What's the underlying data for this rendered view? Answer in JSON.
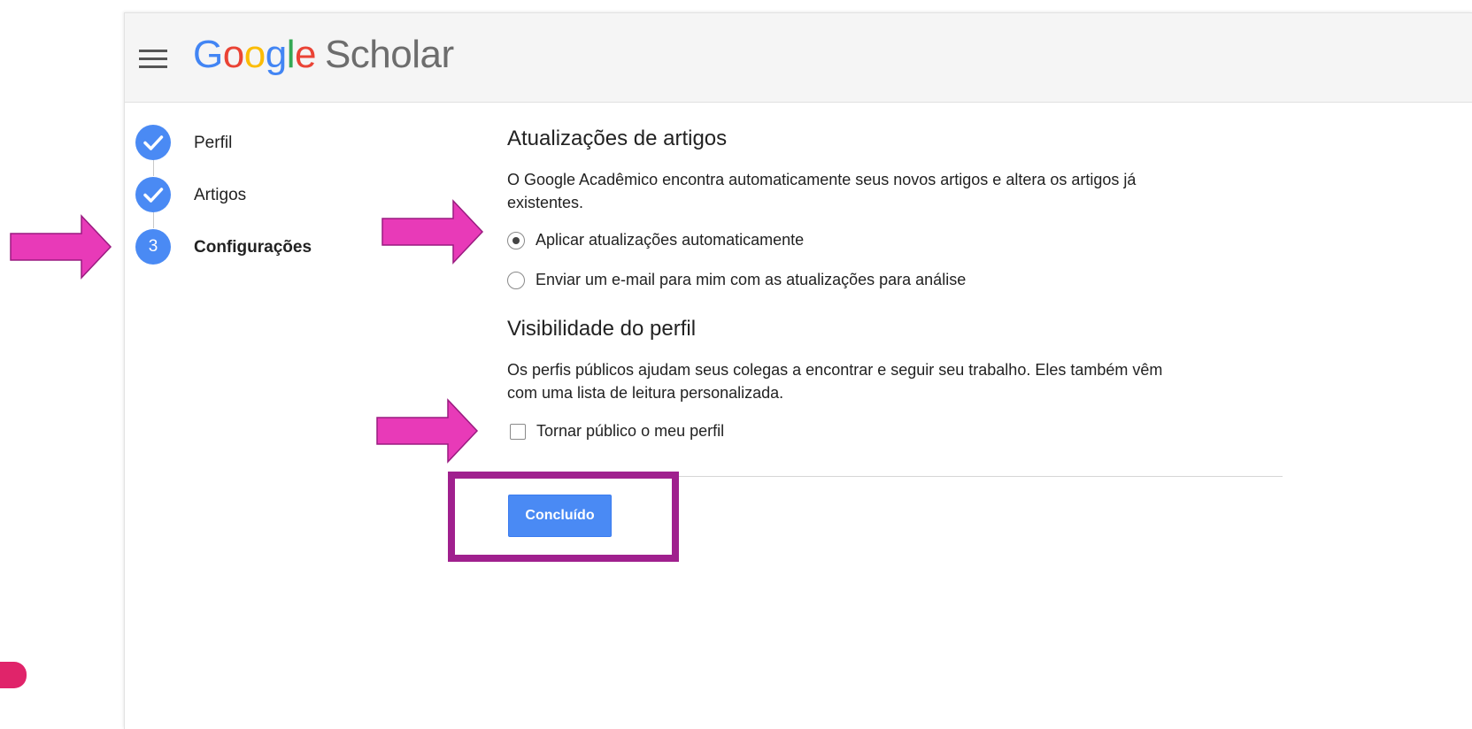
{
  "header": {
    "logo_letters": [
      "G",
      "o",
      "o",
      "g",
      "l",
      "e"
    ],
    "product_name": "Scholar"
  },
  "steps": [
    {
      "label": "Perfil",
      "state": "done"
    },
    {
      "label": "Artigos",
      "state": "done"
    },
    {
      "number": "3",
      "label": "Configurações",
      "state": "current"
    }
  ],
  "article_updates": {
    "title": "Atualizações de artigos",
    "description_line1": "O Google Acadêmico encontra automaticamente seus novos artigos e altera os artigos já",
    "description_line2": "existentes.",
    "options": [
      {
        "label": "Aplicar atualizações automaticamente",
        "selected": true
      },
      {
        "label": "Enviar um e-mail para mim com as atualizações para análise",
        "selected": false
      }
    ]
  },
  "profile_visibility": {
    "title": "Visibilidade do perfil",
    "description_line1": "Os perfis públicos ajudam seus colegas a encontrar e seguir seu trabalho. Eles também vêm",
    "description_line2": "com uma lista de leitura personalizada.",
    "checkbox_label": "Tornar público o meu perfil",
    "checked": false
  },
  "done_button_label": "Concluído",
  "colors": {
    "accent_blue": "#4a8af4",
    "annotation_arrow": "#e83ab8",
    "annotation_box": "#a0208e"
  }
}
